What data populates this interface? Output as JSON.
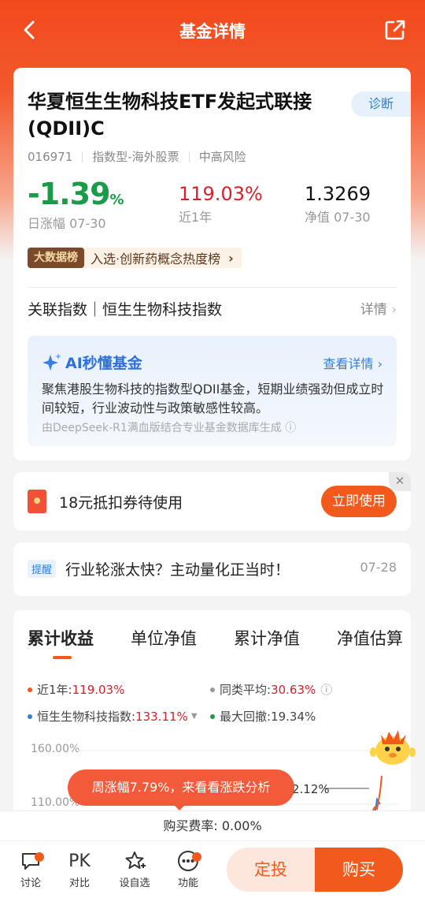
{
  "nav": {
    "title": "基金详情"
  },
  "fund": {
    "name": "华夏恒生生物科技ETF发起式联接(QDII)C",
    "diagnose_label": "诊断",
    "code": "016971",
    "type": "指数型-海外股票",
    "risk": "中高风险",
    "daily_change": "-1.39",
    "daily_change_unit": "%",
    "daily_change_label": "日涨幅 07-30",
    "year_return": "119.03%",
    "year_return_label": "近1年",
    "nav_value": "1.3269",
    "nav_label": "净值 07-30",
    "bigdata_tag": "大数据榜",
    "bigdata_text": "入选·创新药概念热度榜",
    "index_label": "关联指数｜恒生生物科技指数",
    "index_more": "详情"
  },
  "ai": {
    "title": "AI秒懂基金",
    "more": "查看详情",
    "desc": "聚焦港股生物科技的指数型QDII基金，短期业绩强劲但成立时间较短，行业波动性与政策敏感性较高。",
    "source": "由DeepSeek-R1满血版结合专业基金数据库生成"
  },
  "coupon": {
    "text": "18元抵扣券待使用",
    "button": "立即使用",
    "close": "✕"
  },
  "notice": {
    "badge": "提醒",
    "text": "行业轮涨太快？主动量化正当时！",
    "date": "07-28"
  },
  "tabs": [
    "累计收益",
    "单位净值",
    "累计净值",
    "净值估算"
  ],
  "legend": {
    "year_label": "近1年:",
    "year_value": "119.03%",
    "peer_label": "同类平均:",
    "peer_value": "30.63%",
    "index_label": "恒生生物科技指数:",
    "index_value": "133.11%",
    "drawdown_label": "最大回撤:",
    "drawdown_value": "19.34%"
  },
  "chart": {
    "ytick_top": "160.00%",
    "ytick_mid": "110.00%",
    "ref_label": "2.12%",
    "bubble": "周涨幅7.79%，来看看涨跌分析",
    "colors": {
      "fund": "#f25a1d",
      "index": "#2f80d8",
      "peer": "#999999"
    }
  },
  "fee": "购买费率: 0.00%",
  "bottom": {
    "discuss": "讨论",
    "pk_icon": "PK",
    "compare": "对比",
    "watch": "设自选",
    "func": "功能",
    "dingtou": "定投",
    "buy": "购买"
  }
}
